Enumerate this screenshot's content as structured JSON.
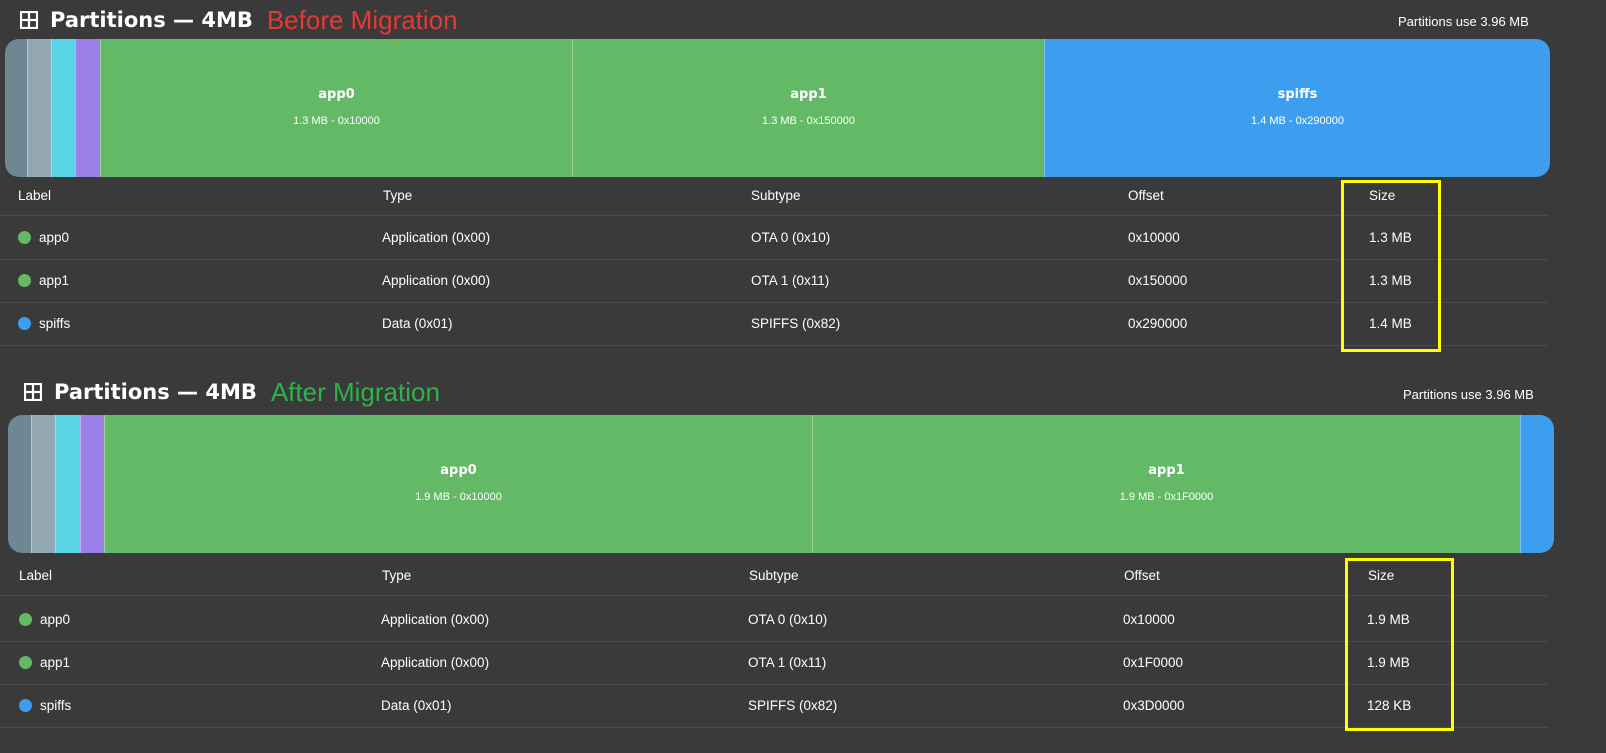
{
  "colors": {
    "background": "#3a3a3a",
    "bootloader": "#6f8793",
    "nvs": "#93a7b3",
    "otadata": "#59d3e6",
    "phy": "#9c7ee8",
    "app": "#63b965",
    "spiffs": "#3d9ef0",
    "before_label": "#e53935",
    "after_label": "#2eb24a",
    "highlight": "#ffff00"
  },
  "before": {
    "title": "Partitions — 4MB",
    "subtitle": "Before Migration",
    "usage": "Partitions use 3.96 MB",
    "bar": [
      {
        "name": "",
        "sub": "",
        "color_key": "bootloader"
      },
      {
        "name": "",
        "sub": "",
        "color_key": "nvs"
      },
      {
        "name": "",
        "sub": "",
        "color_key": "otadata"
      },
      {
        "name": "",
        "sub": "",
        "color_key": "phy"
      },
      {
        "name": "app0",
        "sub": "1.3 MB - 0x10000",
        "color_key": "app"
      },
      {
        "name": "app1",
        "sub": "1.3 MB - 0x150000",
        "color_key": "app"
      },
      {
        "name": "spiffs",
        "sub": "1.4 MB - 0x290000",
        "color_key": "spiffs"
      }
    ],
    "headers": [
      "Label",
      "Type",
      "Subtype",
      "Offset",
      "Size"
    ],
    "rows": [
      {
        "label": "app0",
        "type": "Application (0x00)",
        "subtype": "OTA 0 (0x10)",
        "offset": "0x10000",
        "size": "1.3 MB",
        "color_key": "app"
      },
      {
        "label": "app1",
        "type": "Application (0x00)",
        "subtype": "OTA 1 (0x11)",
        "offset": "0x150000",
        "size": "1.3 MB",
        "color_key": "app"
      },
      {
        "label": "spiffs",
        "type": "Data (0x01)",
        "subtype": "SPIFFS (0x82)",
        "offset": "0x290000",
        "size": "1.4 MB",
        "color_key": "spiffs"
      }
    ]
  },
  "after": {
    "title": "Partitions — 4MB",
    "subtitle": "After Migration",
    "usage": "Partitions use 3.96 MB",
    "bar": [
      {
        "name": "",
        "sub": "",
        "color_key": "bootloader"
      },
      {
        "name": "",
        "sub": "",
        "color_key": "nvs"
      },
      {
        "name": "",
        "sub": "",
        "color_key": "otadata"
      },
      {
        "name": "",
        "sub": "",
        "color_key": "phy"
      },
      {
        "name": "app0",
        "sub": "1.9 MB - 0x10000",
        "color_key": "app"
      },
      {
        "name": "app1",
        "sub": "1.9 MB - 0x1F0000",
        "color_key": "app"
      },
      {
        "name": "",
        "sub": "",
        "color_key": "spiffs"
      }
    ],
    "headers": [
      "Label",
      "Type",
      "Subtype",
      "Offset",
      "Size"
    ],
    "rows": [
      {
        "label": "app0",
        "type": "Application (0x00)",
        "subtype": "OTA 0 (0x10)",
        "offset": "0x10000",
        "size": "1.9 MB",
        "color_key": "app"
      },
      {
        "label": "app1",
        "type": "Application (0x00)",
        "subtype": "OTA 1 (0x11)",
        "offset": "0x1F0000",
        "size": "1.9 MB",
        "color_key": "app"
      },
      {
        "label": "spiffs",
        "type": "Data (0x01)",
        "subtype": "SPIFFS (0x82)",
        "offset": "0x3D0000",
        "size": "128 KB",
        "color_key": "spiffs"
      }
    ]
  }
}
